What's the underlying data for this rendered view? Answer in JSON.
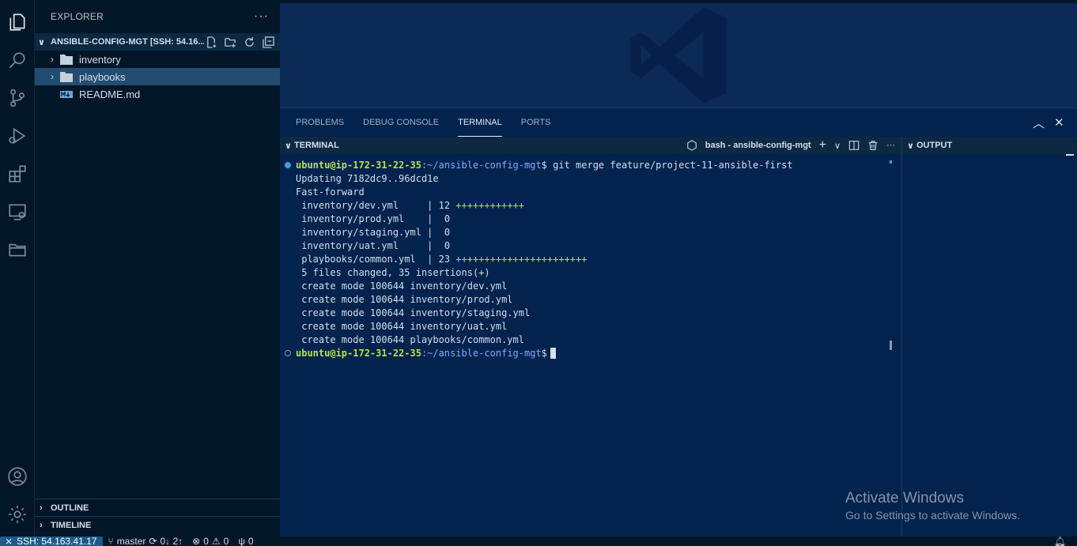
{
  "activity_bar": {
    "icons": [
      "files-icon",
      "search-icon",
      "source-control-icon",
      "run-debug-icon",
      "extensions-icon",
      "remote-explorer-icon",
      "folder-icon",
      "account-icon",
      "gear-icon"
    ]
  },
  "sidebar": {
    "title": "EXPLORER",
    "more": "···",
    "folder_title": "ANSIBLE-CONFIG-MGT [SSH: 54.16...",
    "items": [
      {
        "label": "inventory",
        "type": "folder"
      },
      {
        "label": "playbooks",
        "type": "folder"
      },
      {
        "label": "README.md",
        "type": "file"
      }
    ],
    "outline": "OUTLINE",
    "timeline": "TIMELINE"
  },
  "panel": {
    "tabs": [
      "PROBLEMS",
      "DEBUG CONSOLE",
      "TERMINAL",
      "PORTS"
    ],
    "active_tab": "TERMINAL",
    "terminal_header": "TERMINAL",
    "shell_label": "bash - ansible-config-mgt",
    "output_header": "OUTPUT"
  },
  "terminal": {
    "user_host": "ubuntu@ip-172-31-22-35",
    "path": ":~/ansible-config-mgt",
    "prompt_end": "$",
    "command": " git merge feature/project-11-ansible-first",
    "lines": [
      "Updating 7182dc9..96dcd1e",
      "Fast-forward"
    ],
    "diffstat": [
      {
        "file": " inventory/dev.yml     | 12 ",
        "plus": "++++++++++++"
      },
      {
        "file": " inventory/prod.yml    |  0",
        "plus": ""
      },
      {
        "file": " inventory/staging.yml |  0",
        "plus": ""
      },
      {
        "file": " inventory/uat.yml     |  0",
        "plus": ""
      },
      {
        "file": " playbooks/common.yml  | 23 ",
        "plus": "+++++++++++++++++++++++"
      }
    ],
    "summary": [
      " 5 files changed, 35 insertions(+)",
      " create mode 100644 inventory/dev.yml",
      " create mode 100644 inventory/prod.yml",
      " create mode 100644 inventory/staging.yml",
      " create mode 100644 inventory/uat.yml",
      " create mode 100644 playbooks/common.yml"
    ]
  },
  "watermark": {
    "title": "Activate Windows",
    "subtitle": "Go to Settings to activate Windows."
  },
  "statusbar": {
    "remote": "SSH: 54.163.41.17",
    "branch": "master",
    "sync": "0↓ 2↑",
    "errors": "0",
    "warnings": "0",
    "ports": "0"
  },
  "colors": {
    "background": "#011627",
    "panel": "#01234e",
    "accent": "#3f9fdc",
    "prompt_user": "#b7e24a",
    "prompt_path": "#82aaff"
  }
}
